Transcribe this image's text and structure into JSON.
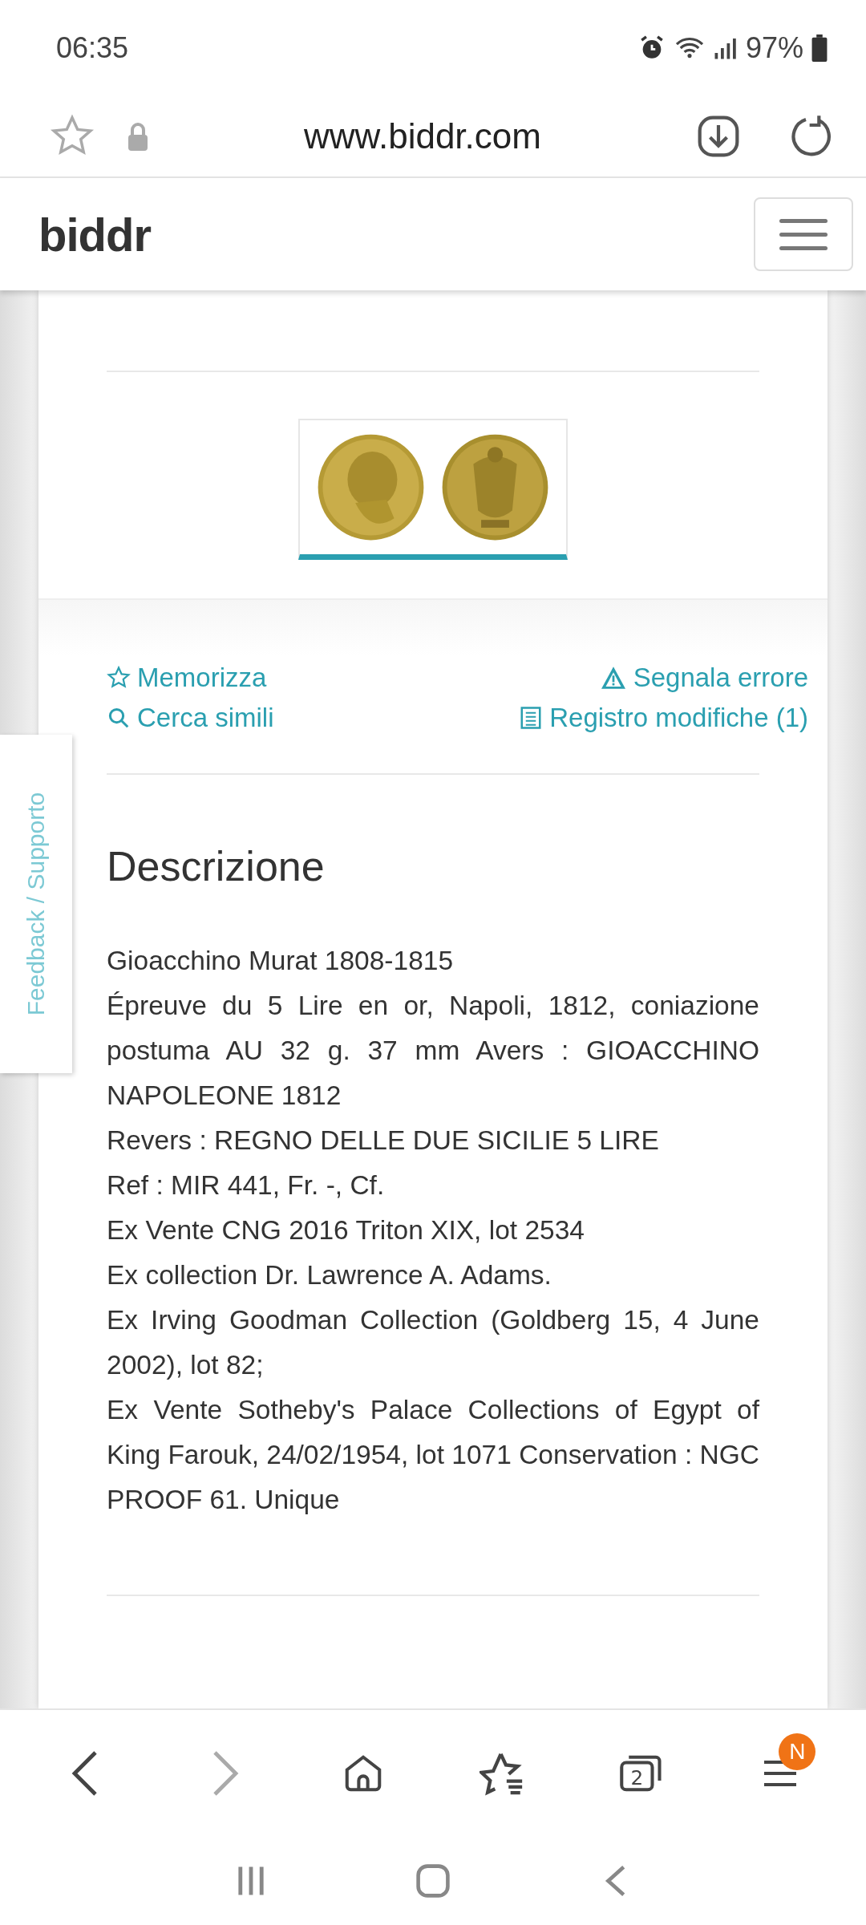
{
  "status_bar": {
    "time": "06:35",
    "battery": "97%"
  },
  "browser": {
    "url": "www.biddr.com",
    "tabs_count": "2",
    "menu_badge": "N"
  },
  "site": {
    "logo": "biddr"
  },
  "gallery": {
    "thumbnails": [
      {
        "kind": "picture",
        "selected": true
      }
    ]
  },
  "actions": {
    "left": [
      {
        "kind": "star",
        "label": "Memorizza"
      },
      {
        "kind": "search",
        "label": "Cerca simili"
      }
    ],
    "right": [
      {
        "kind": "warning",
        "label": "Segnala errore"
      },
      {
        "kind": "list",
        "label": "Registro modifiche (1)"
      }
    ]
  },
  "description": {
    "title": "Descrizione",
    "lines": [
      "Gioacchino Murat 1808-1815",
      "Épreuve du 5 Lire en or, Napoli, 1812, coniazione postuma AU 32 g. 37 mm Avers : GIOACCHINO NAPOLEONE 1812",
      "Revers : REGNO DELLE DUE SICILIE 5 LIRE",
      "Ref : MIR 441, Fr. -, Cf.",
      "Ex Vente CNG 2016 Triton XIX, lot 2534",
      "Ex collection Dr. Lawrence A. Adams.",
      "Ex Irving Goodman Collection (Goldberg 15, 4 June 2002), lot 82;",
      "Ex Vente Sotheby's Palace Collections of Egypt of King Farouk, 24/02/1954, lot 1071 Conservation : NGC PROOF 61. Unique"
    ]
  },
  "feedback_tab": {
    "label": "Feedback / Supporto"
  }
}
